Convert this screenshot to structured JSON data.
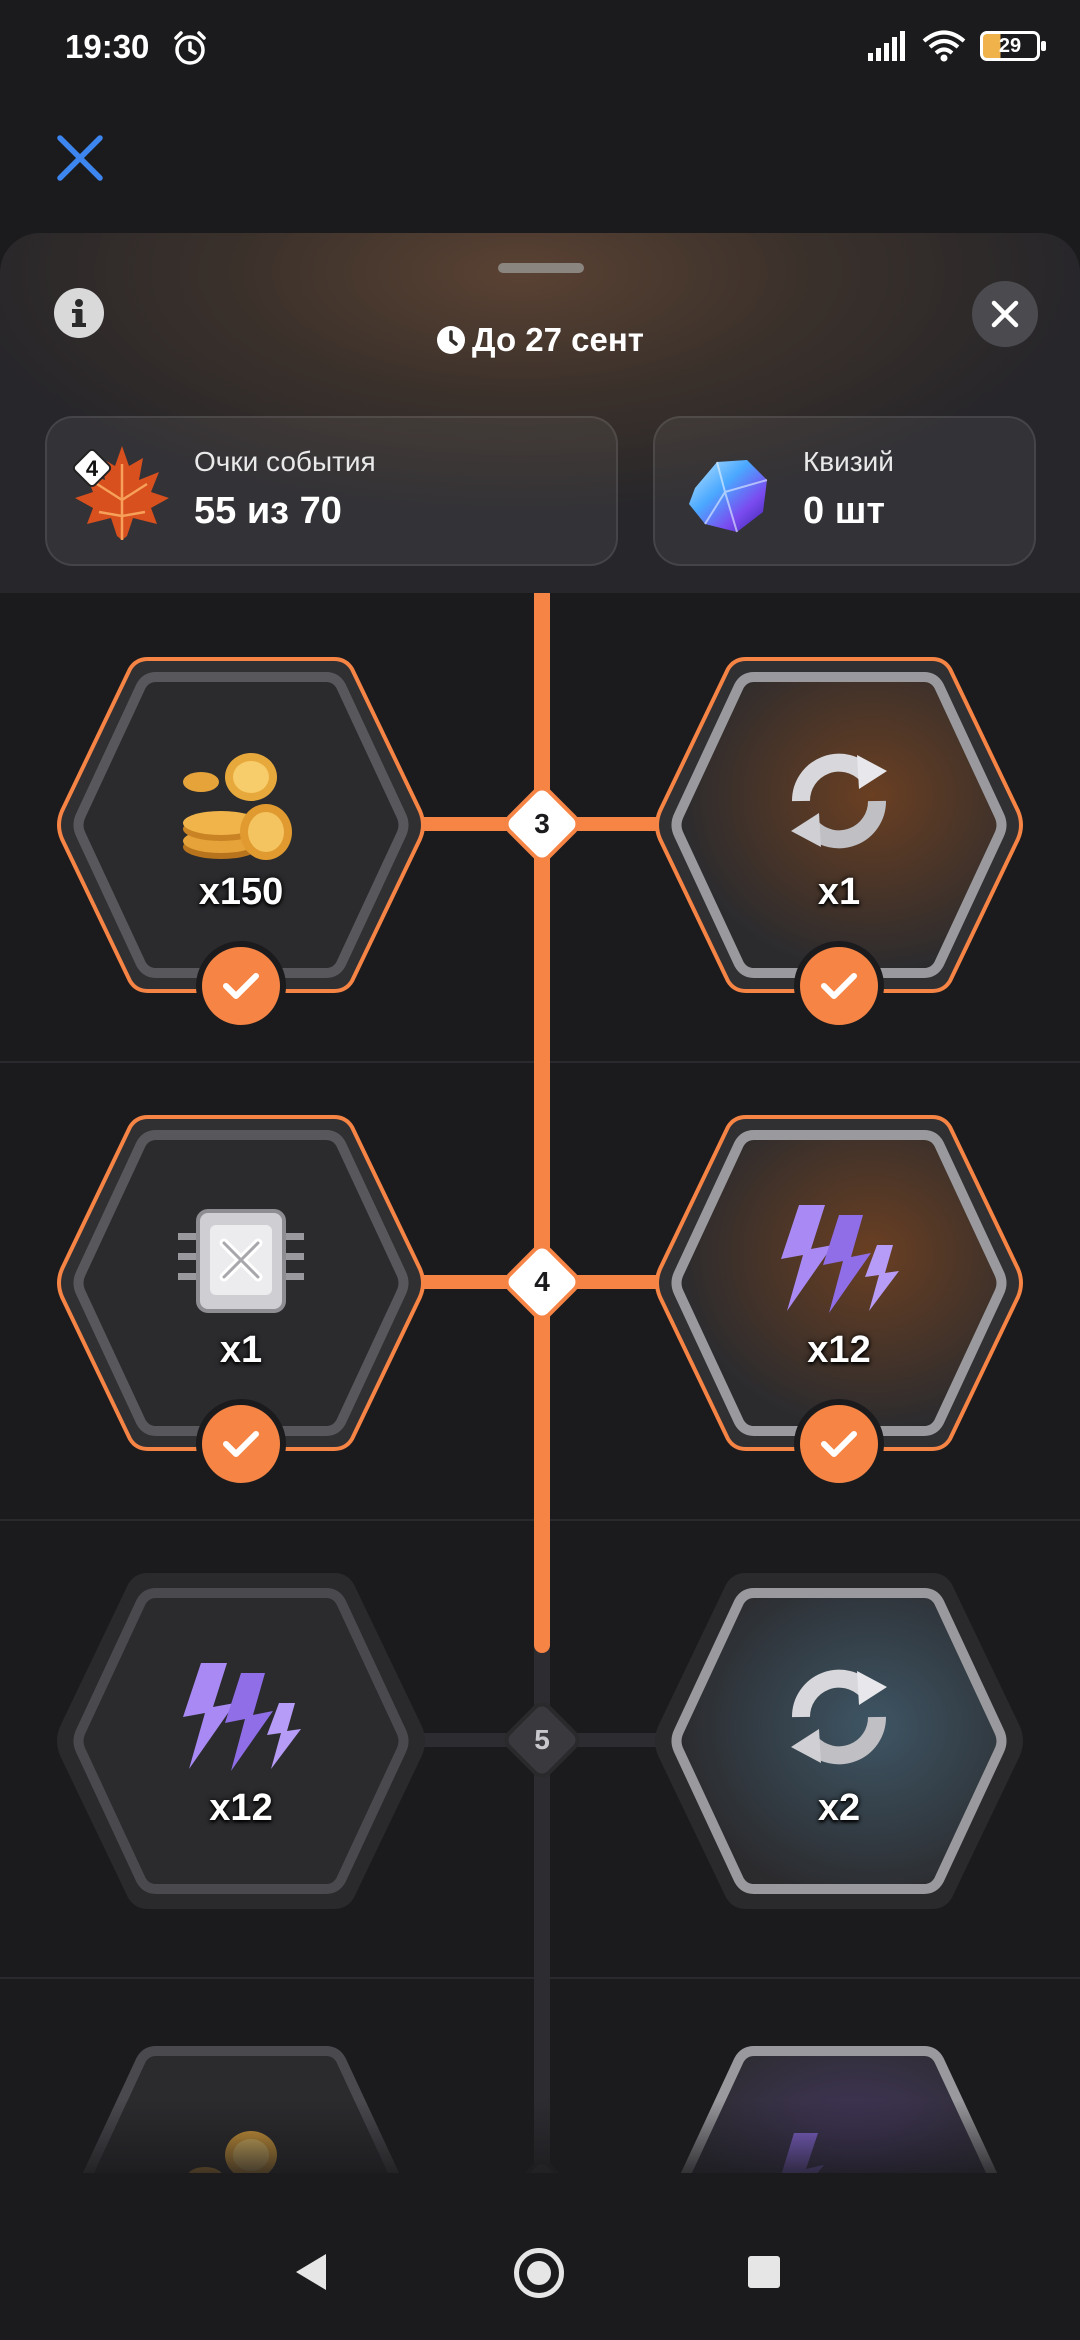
{
  "status_bar": {
    "time": "19:30",
    "battery": "29"
  },
  "header": {
    "deadline": "До 27 сент",
    "points_card": {
      "level": "4",
      "label": "Очки события",
      "value": "55 из 70"
    },
    "quizy_card": {
      "label": "Квизий",
      "value": "0 шт"
    }
  },
  "levels": [
    {
      "number": "3",
      "reached": true,
      "left": {
        "reward": "coins",
        "qty": "x150",
        "claimed": true
      },
      "right": {
        "reward": "refresh",
        "qty": "x1",
        "claimed": true
      }
    },
    {
      "number": "4",
      "reached": true,
      "left": {
        "reward": "chip",
        "qty": "x1",
        "claimed": true
      },
      "right": {
        "reward": "energy",
        "qty": "x12",
        "claimed": true
      }
    },
    {
      "number": "5",
      "reached": false,
      "left": {
        "reward": "energy",
        "qty": "x12",
        "claimed": false
      },
      "right": {
        "reward": "refresh",
        "qty": "x2",
        "claimed": false
      }
    }
  ],
  "accent_color": "#f58445"
}
